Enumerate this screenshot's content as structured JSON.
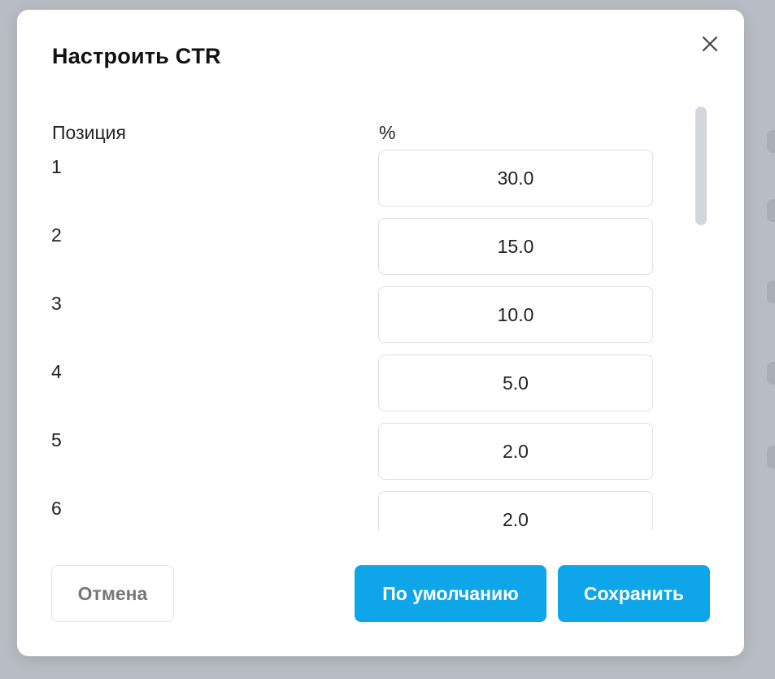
{
  "modal": {
    "title": "Настроить CTR",
    "close_icon": "close-icon"
  },
  "table": {
    "headers": {
      "position": "Позиция",
      "percent": "%"
    },
    "rows": [
      {
        "position": "1",
        "value": "30.0"
      },
      {
        "position": "2",
        "value": "15.0"
      },
      {
        "position": "3",
        "value": "10.0"
      },
      {
        "position": "4",
        "value": "5.0"
      },
      {
        "position": "5",
        "value": "2.0"
      },
      {
        "position": "6",
        "value": "2.0"
      }
    ]
  },
  "footer": {
    "cancel_label": "Отмена",
    "default_label": "По умолчанию",
    "save_label": "Сохранить"
  },
  "colors": {
    "primary": "#0ea5e9",
    "overlay": "#b8bcc4",
    "border": "#dcdfe4"
  }
}
